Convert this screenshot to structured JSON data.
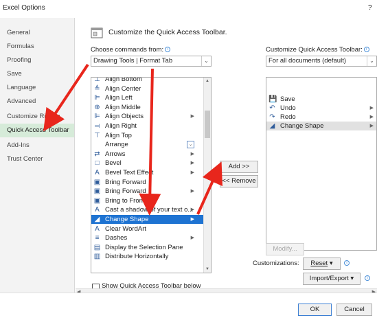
{
  "window": {
    "title": "Excel Options",
    "help": "?"
  },
  "nav": {
    "items": [
      {
        "label": "General"
      },
      {
        "label": "Formulas"
      },
      {
        "label": "Proofing"
      },
      {
        "label": "Save"
      },
      {
        "label": "Language"
      },
      {
        "label": "Advanced"
      },
      {
        "label": "Customize Ribbon"
      },
      {
        "label": "Quick Access Toolbar",
        "selected": true
      },
      {
        "label": "Add-Ins"
      },
      {
        "label": "Trust Center"
      }
    ]
  },
  "header": {
    "title": "Customize the Quick Access Toolbar."
  },
  "left": {
    "choose_label": "Choose commands from:",
    "choose_value": "Drawing Tools | Format Tab",
    "commands": [
      {
        "label": "Align Bottom",
        "icon": "align-bottom-icon",
        "glyph": "⊥"
      },
      {
        "label": "Align Center",
        "icon": "align-center-icon",
        "glyph": "≜"
      },
      {
        "label": "Align Left",
        "icon": "align-left-icon",
        "glyph": "⊫"
      },
      {
        "label": "Align Middle",
        "icon": "align-middle-icon",
        "glyph": "⊕"
      },
      {
        "label": "Align Objects",
        "icon": "align-objects-icon",
        "glyph": "⊫",
        "submenu": true
      },
      {
        "label": "Align Right",
        "icon": "align-right-icon",
        "glyph": "⫤"
      },
      {
        "label": "Align Top",
        "icon": "align-top-icon",
        "glyph": "⊤"
      },
      {
        "label": "Arrange",
        "icon": "arrange-icon",
        "glyph": "",
        "dropdown": true
      },
      {
        "label": "Arrows",
        "icon": "arrows-icon",
        "glyph": "⇄",
        "submenu": true
      },
      {
        "label": "Bevel",
        "icon": "bevel-icon",
        "glyph": "□",
        "submenu": true
      },
      {
        "label": "Bevel Text Effect",
        "icon": "text-effect-icon",
        "glyph": "A",
        "submenu": true
      },
      {
        "label": "Bring Forward",
        "icon": "bring-forward-icon",
        "glyph": "▣"
      },
      {
        "label": "Bring Forward",
        "icon": "bring-forward-icon",
        "glyph": "▣",
        "submenu": true
      },
      {
        "label": "Bring to Front",
        "icon": "bring-front-icon",
        "glyph": "▣"
      },
      {
        "label": "Cast a shadow of your text o...",
        "icon": "text-shadow-icon",
        "glyph": "A",
        "submenu": true
      },
      {
        "label": "Change Shape",
        "icon": "change-shape-icon",
        "glyph": "◢",
        "submenu": true,
        "selected": true
      },
      {
        "label": "Clear WordArt",
        "icon": "clear-wordart-icon",
        "glyph": "A"
      },
      {
        "label": "Dashes",
        "icon": "dashes-icon",
        "glyph": "≡",
        "submenu": true
      },
      {
        "label": "Display the Selection Pane",
        "icon": "selection-pane-icon",
        "glyph": "▤"
      },
      {
        "label": "Distribute Horizontally",
        "icon": "distribute-icon",
        "glyph": "▥"
      }
    ],
    "show_below_label": "Show Quick Access Toolbar below the Ribbon"
  },
  "middle": {
    "add_label": "Add >>",
    "remove_label": "<< Remove"
  },
  "right": {
    "customize_label": "Customize Quick Access Toolbar:",
    "customize_value": "For all documents (default)",
    "items": [
      {
        "label": "Save",
        "icon": "save-icon",
        "glyph": "💾"
      },
      {
        "label": "Undo",
        "icon": "undo-icon",
        "glyph": "↶",
        "submenu": true
      },
      {
        "label": "Redo",
        "icon": "redo-icon",
        "glyph": "↷",
        "submenu": true
      },
      {
        "label": "Change Shape",
        "icon": "change-shape-icon",
        "glyph": "◢",
        "submenu": true,
        "selected": true
      }
    ],
    "modify_label": "Modify...",
    "customizations_label": "Customizations:",
    "reset_label": "Reset",
    "import_export_label": "Import/Export"
  },
  "footer": {
    "ok_label": "OK",
    "cancel_label": "Cancel"
  },
  "colors": {
    "nav_selected": "#d6ebd9",
    "list_selected": "#1e73d2",
    "annotation_arrow": "#e8261c"
  }
}
